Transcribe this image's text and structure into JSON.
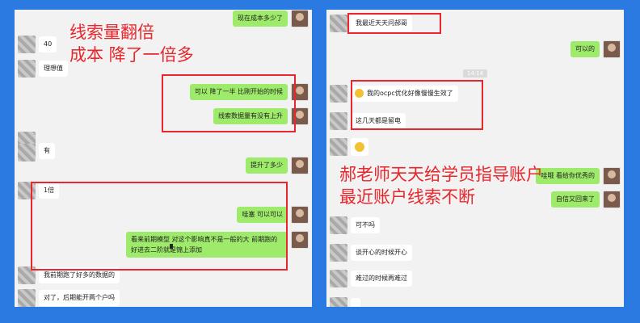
{
  "left": {
    "annotation_line1": "线索量翻倍",
    "annotation_line2": "成本 降了一倍多",
    "messages": [
      {
        "text": "现在成本多少了"
      },
      {
        "text": "40"
      },
      {
        "text": "理想值"
      },
      {
        "text": "可以  降了一半  比刚开始的时候"
      },
      {
        "text": "线索数据量有没有上升"
      },
      {
        "text": "有"
      },
      {
        "text": "提升了多少"
      },
      {
        "text": "1倍"
      },
      {
        "text": "哇塞  可以可以"
      },
      {
        "text": "看来前期模型 对这个影响真不是一般的大  前期跑的好进去二阶就是锦上添加"
      },
      {
        "text": "我前期跑了好多的数据的"
      },
      {
        "text": "对了，后期能开两个户吗"
      }
    ]
  },
  "right": {
    "annotation_line1": "郝老师天天给学员指导账户",
    "annotation_line2": "最近账户线索不断",
    "timestamp": "14:14",
    "messages": [
      {
        "text": "我最近天天问郝哥"
      },
      {
        "text": "可以的"
      },
      {
        "text": "我的ocpc优化好像慢慢生效了"
      },
      {
        "text": "这几天都是留电"
      },
      {
        "text": "哇哦  看给你优秀的"
      },
      {
        "text": "自信又回来了"
      },
      {
        "text": "可不吗"
      },
      {
        "text": "谈开心的时候开心"
      },
      {
        "text": "难过的时候再难过"
      }
    ]
  },
  "colors": {
    "background": "#2a7ae2",
    "annotation_red": "#e8262c",
    "bubble_out": "#9eea6a",
    "bubble_in": "#ffffff"
  }
}
